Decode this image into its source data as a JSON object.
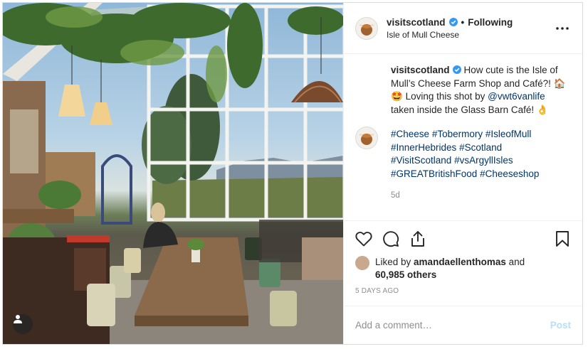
{
  "post": {
    "username": "visitscotland",
    "follow_status": "Following",
    "separator": "•",
    "location": "Isle of Mull Cheese",
    "caption_text_1": "How cute is the Isle of Mull’s Cheese Farm Shop and Café?! ",
    "caption_emoji_1": "🏠🤩",
    "caption_text_2": " Loving this shot by ",
    "caption_mention": "@vwt6vanlife",
    "caption_text_3": " taken inside the Glass Barn Café! ",
    "caption_emoji_2": "👌",
    "hashtags": [
      "#Cheese",
      "#Tobermory",
      "#IsleofMull",
      "#InnerHebrides",
      "#Scotland",
      "#VisitScotland",
      "#vsArgyllIsles",
      "#GREATBritishFood",
      "#Cheeseshop"
    ],
    "time_ago": "5d",
    "liked_by_prefix": "Liked by ",
    "liked_by_user": "amandaellenthomas",
    "liked_by_and": " and",
    "other_likes": "60,985 others",
    "posted_ago": "5 DAYS AGO",
    "comment_placeholder": "Add a comment…",
    "post_label": "Post"
  },
  "colors": {
    "link": "#003569",
    "verified": "#3897f0",
    "muted": "#8e8e8e",
    "post_disabled": "#b2dffc"
  }
}
